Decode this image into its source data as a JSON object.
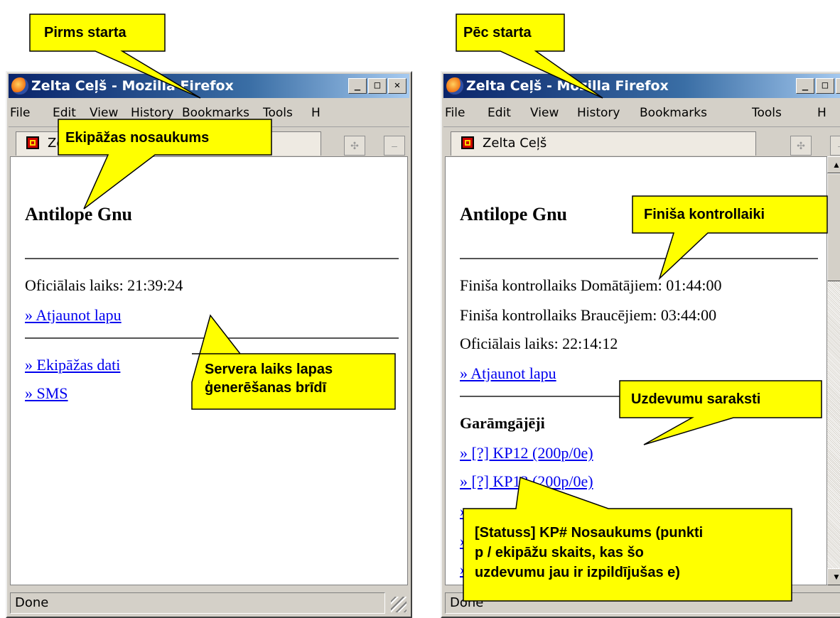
{
  "windows": [
    {
      "title": "Zelta Ceļš - Mozilla Firefox",
      "menu": [
        "File",
        "Edit",
        "View",
        "History",
        "Bookmarks",
        "Tools",
        "H"
      ],
      "tab_label": "Zelta Ceļš",
      "team_name": "Antilope Gnu",
      "official_time": "Oficiālais laiks: 21:39:24",
      "refresh_link": "» Atjaunot lapu",
      "team_data_link": "» Ekipāžas dati",
      "sms_link": "» SMS",
      "status": "Done"
    },
    {
      "title": "Zelta Ceļš - Mozilla Firefox",
      "menu": [
        "File",
        "Edit",
        "View",
        "History",
        "Bookmarks",
        "Tools",
        "H"
      ],
      "tab_label": "Zelta Ceļš",
      "team_name": "Antilope Gnu",
      "finish_thinkers": "Finiša kontrollaiks Domātājiem: 01:44:00",
      "finish_drivers": "Finiša kontrollaiks Braucējiem: 03:44:00",
      "official_time": "Oficiālais laiks: 22:14:12",
      "refresh_link": "» Atjaunot lapu",
      "section_title": "Garāmgājēji",
      "task_links": [
        "» [?] KP12 (200p/0e)",
        "» [?] KP13 (200p/0e)",
        "»",
        "»",
        "»"
      ],
      "status": "Done"
    }
  ],
  "callouts": {
    "before_start": "Pirms starta",
    "after_start": "Pēc starta",
    "team_name": "Ekipāžas nosaukums",
    "server_time_line1": "Servera laiks lapas",
    "server_time_line2": "ģenerēšanas brīdī",
    "finish_times": "Finiša kontrollaiki",
    "task_lists": "Uzdevumu saraksti",
    "task_format_line1": "[Statuss] KP# Nosaukums (punkti",
    "task_format_line2": "p / ekipāžu skaits, kas šo",
    "task_format_line3": "uzdevumu jau ir izpildījušas e)"
  },
  "colors": {
    "callout_fill": "#ffff00",
    "link": "#0000ee",
    "titlebar": "#0a246a"
  }
}
